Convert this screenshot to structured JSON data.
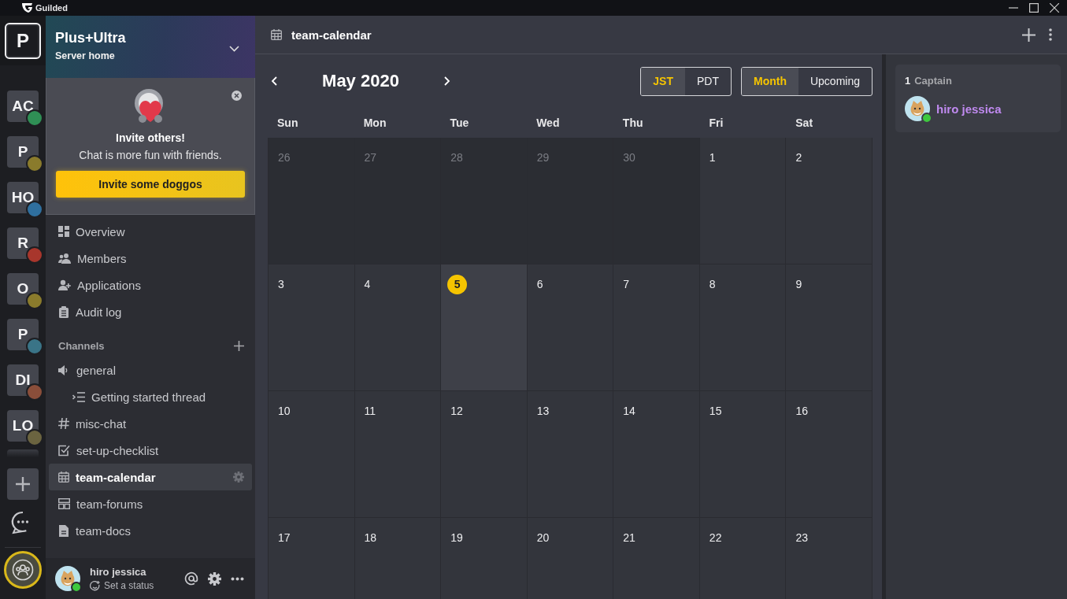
{
  "app": {
    "title": "Guilded"
  },
  "servers": [
    {
      "label": "P",
      "selected": true
    },
    {
      "label": "AC",
      "selected": false,
      "color": "#2f8f55"
    },
    {
      "label": "P",
      "selected": false,
      "color": "#8a7b2c"
    },
    {
      "label": "HO",
      "selected": false,
      "color": "#2f6f9e"
    },
    {
      "label": "R",
      "selected": false,
      "color": "#a8362c"
    },
    {
      "label": "O",
      "selected": false,
      "color": "#8a7b2c"
    },
    {
      "label": "P",
      "selected": false,
      "color": "#3a7487"
    },
    {
      "label": "DI",
      "selected": false,
      "color": "#8a4e3a"
    },
    {
      "label": "LO",
      "selected": false,
      "color": "#6b6440"
    }
  ],
  "server_header": {
    "name": "Plus+Ultra",
    "subtitle": "Server home"
  },
  "invite_card": {
    "title": "Invite others!",
    "text": "Chat is more fun with friends.",
    "button": "Invite some doggos"
  },
  "nav": [
    {
      "kind": "overview",
      "label": "Overview"
    },
    {
      "kind": "members",
      "label": "Members"
    },
    {
      "kind": "applications",
      "label": "Applications"
    },
    {
      "kind": "audit",
      "label": "Audit log"
    }
  ],
  "channels_heading": "Channels",
  "channels": [
    {
      "kind": "voice",
      "label": "general",
      "selected": false,
      "children": [
        {
          "kind": "thread",
          "label": "Getting started thread",
          "selected": false
        }
      ]
    },
    {
      "kind": "text",
      "label": "misc-chat",
      "selected": false
    },
    {
      "kind": "checklist",
      "label": "set-up-checklist",
      "selected": false
    },
    {
      "kind": "calendar",
      "label": "team-calendar",
      "selected": true
    },
    {
      "kind": "forums",
      "label": "team-forums",
      "selected": false
    },
    {
      "kind": "docs",
      "label": "team-docs",
      "selected": false
    }
  ],
  "user": {
    "name": "hiro jessica",
    "status_placeholder": "Set a status",
    "online": true
  },
  "channel_header": {
    "title": "team-calendar"
  },
  "calendar": {
    "month": "May 2020",
    "timezones": [
      {
        "label": "JST",
        "selected": true
      },
      {
        "label": "PDT",
        "selected": false
      }
    ],
    "views": [
      {
        "label": "Month",
        "selected": true
      },
      {
        "label": "Upcoming",
        "selected": false
      }
    ],
    "weekdays": [
      "Sun",
      "Mon",
      "Tue",
      "Wed",
      "Thu",
      "Fri",
      "Sat"
    ],
    "weeks": [
      {
        "days": [
          {
            "day": "26",
            "outside_month": true,
            "today": false
          },
          {
            "day": "27",
            "outside_month": true,
            "today": false
          },
          {
            "day": "28",
            "outside_month": true,
            "today": false
          },
          {
            "day": "29",
            "outside_month": true,
            "today": false
          },
          {
            "day": "30",
            "outside_month": true,
            "today": false
          },
          {
            "day": "1",
            "outside_month": false,
            "today": false
          },
          {
            "day": "2",
            "outside_month": false,
            "today": false
          }
        ]
      },
      {
        "days": [
          {
            "day": "3",
            "outside_month": false,
            "today": false
          },
          {
            "day": "4",
            "outside_month": false,
            "today": false
          },
          {
            "day": "5",
            "outside_month": false,
            "today": true
          },
          {
            "day": "6",
            "outside_month": false,
            "today": false
          },
          {
            "day": "7",
            "outside_month": false,
            "today": false
          },
          {
            "day": "8",
            "outside_month": false,
            "today": false
          },
          {
            "day": "9",
            "outside_month": false,
            "today": false
          }
        ]
      },
      {
        "days": [
          {
            "day": "10",
            "outside_month": false,
            "today": false
          },
          {
            "day": "11",
            "outside_month": false,
            "today": false
          },
          {
            "day": "12",
            "outside_month": false,
            "today": false
          },
          {
            "day": "13",
            "outside_month": false,
            "today": false
          },
          {
            "day": "14",
            "outside_month": false,
            "today": false
          },
          {
            "day": "15",
            "outside_month": false,
            "today": false
          },
          {
            "day": "16",
            "outside_month": false,
            "today": false
          }
        ]
      },
      {
        "days": [
          {
            "day": "17",
            "outside_month": false,
            "today": false
          },
          {
            "day": "18",
            "outside_month": false,
            "today": false
          },
          {
            "day": "19",
            "outside_month": false,
            "today": false
          },
          {
            "day": "20",
            "outside_month": false,
            "today": false
          },
          {
            "day": "21",
            "outside_month": false,
            "today": false
          },
          {
            "day": "22",
            "outside_month": false,
            "today": false
          },
          {
            "day": "23",
            "outside_month": false,
            "today": false
          }
        ]
      }
    ]
  },
  "members_panel": {
    "groups": [
      {
        "count": "1",
        "label": "Captain",
        "members": [
          {
            "name": "hiro jessica",
            "online": true
          }
        ]
      }
    ]
  }
}
